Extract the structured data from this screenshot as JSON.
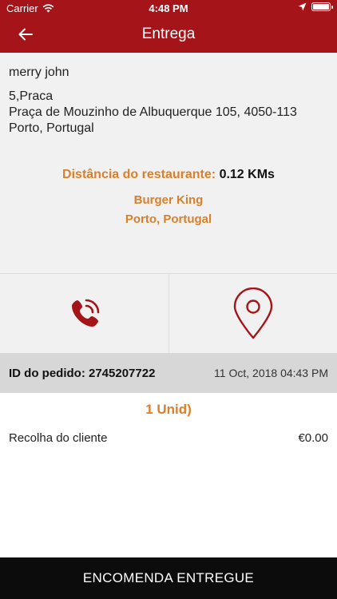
{
  "status_bar": {
    "carrier": "Carrier",
    "time": "4:48 PM"
  },
  "nav": {
    "title": "Entrega"
  },
  "customer": {
    "name": "merry john",
    "address_lines": [
      "5,Praca",
      "Praça de Mouzinho de Albuquerque 105,  4050-113",
      "Porto,  Portugal"
    ]
  },
  "distance": {
    "label": "Distância do restaurante:",
    "value": "0.12 KMs"
  },
  "restaurant": {
    "name": "Burger King",
    "location": "Porto, Portugal"
  },
  "actions": {
    "call_icon": "phone-ringing-icon",
    "map_icon": "map-pin-icon"
  },
  "order": {
    "id_text": "ID do pedido: 2745207722",
    "date": "11 Oct, 2018 04:43 PM",
    "units": "1 Unid)",
    "line_item_label": "Recolha do cliente",
    "line_item_price": "€0.00"
  },
  "footer": {
    "button_label": "ENCOMENDA ENTREGUE"
  },
  "colors": {
    "header": "#a41418",
    "accent_orange": "#d8802b",
    "icon_red": "#a41418",
    "order_bar": "#d7d7d7",
    "footer_button": "#0c0c0c"
  }
}
